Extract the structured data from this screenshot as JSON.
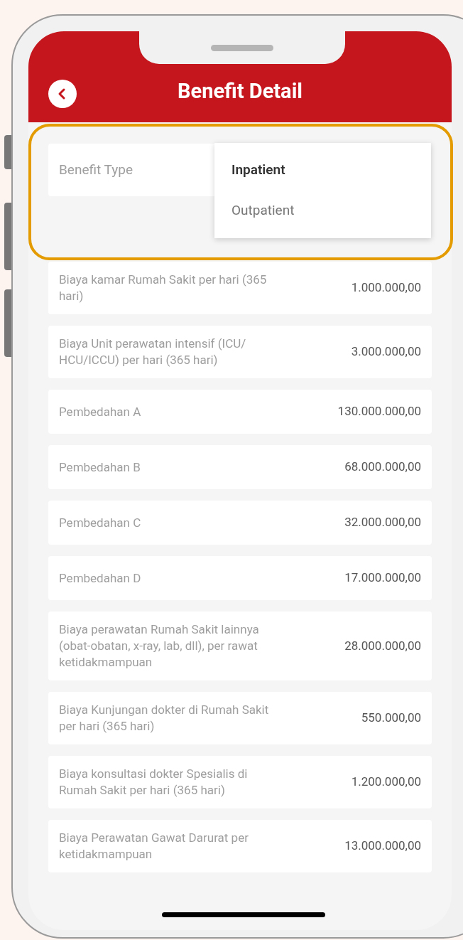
{
  "header": {
    "title": "Benefit Detail"
  },
  "benefit_type": {
    "label": "Benefit Type",
    "options": [
      {
        "label": "Inpatient",
        "selected": true
      },
      {
        "label": "Outpatient",
        "selected": false
      }
    ]
  },
  "benefits": [
    {
      "name": "Biaya kamar Rumah Sakit per hari (365 hari)",
      "amount": "1.000.000,00"
    },
    {
      "name": "Biaya Unit perawatan intensif (ICU/ HCU/ICCU) per hari (365 hari)",
      "amount": "3.000.000,00"
    },
    {
      "name": "Pembedahan A",
      "amount": "130.000.000,00"
    },
    {
      "name": "Pembedahan B",
      "amount": "68.000.000,00"
    },
    {
      "name": "Pembedahan C",
      "amount": "32.000.000,00"
    },
    {
      "name": "Pembedahan D",
      "amount": "17.000.000,00"
    },
    {
      "name": "Biaya perawatan Rumah Sakit lainnya (obat-obatan, x-ray, lab, dll), per rawat ketidakmampuan",
      "amount": "28.000.000,00"
    },
    {
      "name": "Biaya Kunjungan dokter di Rumah Sakit per hari (365 hari)",
      "amount": "550.000,00"
    },
    {
      "name": "Biaya konsultasi dokter Spesialis di Rumah Sakit per hari (365 hari)",
      "amount": "1.200.000,00"
    },
    {
      "name": "Biaya Perawatan Gawat Darurat per ketidakmampuan",
      "amount": "13.000.000,00"
    }
  ]
}
